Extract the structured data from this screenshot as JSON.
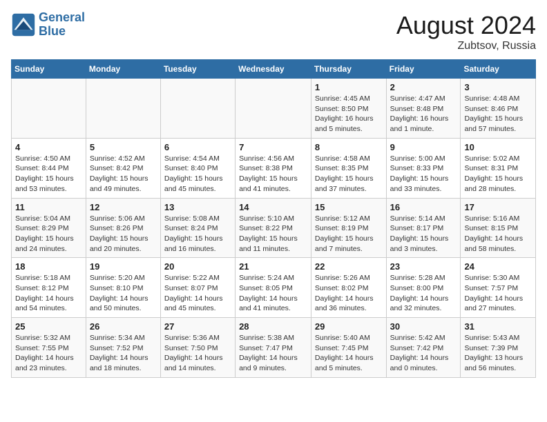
{
  "header": {
    "logo_line1": "General",
    "logo_line2": "Blue",
    "month_year": "August 2024",
    "location": "Zubtsov, Russia"
  },
  "columns": [
    "Sunday",
    "Monday",
    "Tuesday",
    "Wednesday",
    "Thursday",
    "Friday",
    "Saturday"
  ],
  "weeks": [
    [
      {
        "day": "",
        "info": ""
      },
      {
        "day": "",
        "info": ""
      },
      {
        "day": "",
        "info": ""
      },
      {
        "day": "",
        "info": ""
      },
      {
        "day": "1",
        "info": "Sunrise: 4:45 AM\nSunset: 8:50 PM\nDaylight: 16 hours\nand 5 minutes."
      },
      {
        "day": "2",
        "info": "Sunrise: 4:47 AM\nSunset: 8:48 PM\nDaylight: 16 hours\nand 1 minute."
      },
      {
        "day": "3",
        "info": "Sunrise: 4:48 AM\nSunset: 8:46 PM\nDaylight: 15 hours\nand 57 minutes."
      }
    ],
    [
      {
        "day": "4",
        "info": "Sunrise: 4:50 AM\nSunset: 8:44 PM\nDaylight: 15 hours\nand 53 minutes."
      },
      {
        "day": "5",
        "info": "Sunrise: 4:52 AM\nSunset: 8:42 PM\nDaylight: 15 hours\nand 49 minutes."
      },
      {
        "day": "6",
        "info": "Sunrise: 4:54 AM\nSunset: 8:40 PM\nDaylight: 15 hours\nand 45 minutes."
      },
      {
        "day": "7",
        "info": "Sunrise: 4:56 AM\nSunset: 8:38 PM\nDaylight: 15 hours\nand 41 minutes."
      },
      {
        "day": "8",
        "info": "Sunrise: 4:58 AM\nSunset: 8:35 PM\nDaylight: 15 hours\nand 37 minutes."
      },
      {
        "day": "9",
        "info": "Sunrise: 5:00 AM\nSunset: 8:33 PM\nDaylight: 15 hours\nand 33 minutes."
      },
      {
        "day": "10",
        "info": "Sunrise: 5:02 AM\nSunset: 8:31 PM\nDaylight: 15 hours\nand 28 minutes."
      }
    ],
    [
      {
        "day": "11",
        "info": "Sunrise: 5:04 AM\nSunset: 8:29 PM\nDaylight: 15 hours\nand 24 minutes."
      },
      {
        "day": "12",
        "info": "Sunrise: 5:06 AM\nSunset: 8:26 PM\nDaylight: 15 hours\nand 20 minutes."
      },
      {
        "day": "13",
        "info": "Sunrise: 5:08 AM\nSunset: 8:24 PM\nDaylight: 15 hours\nand 16 minutes."
      },
      {
        "day": "14",
        "info": "Sunrise: 5:10 AM\nSunset: 8:22 PM\nDaylight: 15 hours\nand 11 minutes."
      },
      {
        "day": "15",
        "info": "Sunrise: 5:12 AM\nSunset: 8:19 PM\nDaylight: 15 hours\nand 7 minutes."
      },
      {
        "day": "16",
        "info": "Sunrise: 5:14 AM\nSunset: 8:17 PM\nDaylight: 15 hours\nand 3 minutes."
      },
      {
        "day": "17",
        "info": "Sunrise: 5:16 AM\nSunset: 8:15 PM\nDaylight: 14 hours\nand 58 minutes."
      }
    ],
    [
      {
        "day": "18",
        "info": "Sunrise: 5:18 AM\nSunset: 8:12 PM\nDaylight: 14 hours\nand 54 minutes."
      },
      {
        "day": "19",
        "info": "Sunrise: 5:20 AM\nSunset: 8:10 PM\nDaylight: 14 hours\nand 50 minutes."
      },
      {
        "day": "20",
        "info": "Sunrise: 5:22 AM\nSunset: 8:07 PM\nDaylight: 14 hours\nand 45 minutes."
      },
      {
        "day": "21",
        "info": "Sunrise: 5:24 AM\nSunset: 8:05 PM\nDaylight: 14 hours\nand 41 minutes."
      },
      {
        "day": "22",
        "info": "Sunrise: 5:26 AM\nSunset: 8:02 PM\nDaylight: 14 hours\nand 36 minutes."
      },
      {
        "day": "23",
        "info": "Sunrise: 5:28 AM\nSunset: 8:00 PM\nDaylight: 14 hours\nand 32 minutes."
      },
      {
        "day": "24",
        "info": "Sunrise: 5:30 AM\nSunset: 7:57 PM\nDaylight: 14 hours\nand 27 minutes."
      }
    ],
    [
      {
        "day": "25",
        "info": "Sunrise: 5:32 AM\nSunset: 7:55 PM\nDaylight: 14 hours\nand 23 minutes."
      },
      {
        "day": "26",
        "info": "Sunrise: 5:34 AM\nSunset: 7:52 PM\nDaylight: 14 hours\nand 18 minutes."
      },
      {
        "day": "27",
        "info": "Sunrise: 5:36 AM\nSunset: 7:50 PM\nDaylight: 14 hours\nand 14 minutes."
      },
      {
        "day": "28",
        "info": "Sunrise: 5:38 AM\nSunset: 7:47 PM\nDaylight: 14 hours\nand 9 minutes."
      },
      {
        "day": "29",
        "info": "Sunrise: 5:40 AM\nSunset: 7:45 PM\nDaylight: 14 hours\nand 5 minutes."
      },
      {
        "day": "30",
        "info": "Sunrise: 5:42 AM\nSunset: 7:42 PM\nDaylight: 14 hours\nand 0 minutes."
      },
      {
        "day": "31",
        "info": "Sunrise: 5:43 AM\nSunset: 7:39 PM\nDaylight: 13 hours\nand 56 minutes."
      }
    ]
  ]
}
